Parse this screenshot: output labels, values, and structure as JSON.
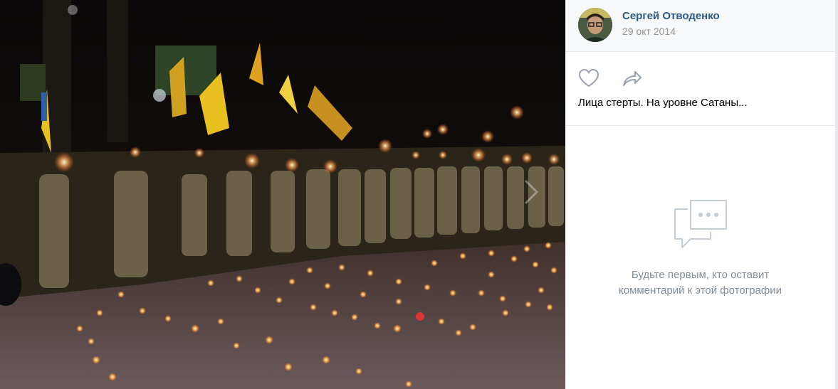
{
  "photo": {
    "alt_icon": "photo-viewer-image",
    "nav_icon": "chevron-right-icon"
  },
  "header": {
    "author": "Сергей Отводенко",
    "date": "29 окт 2014",
    "avatar_icon": "user-avatar"
  },
  "actions": {
    "like_icon": "heart-icon",
    "share_icon": "share-arrow-icon"
  },
  "caption": "Лица стерты. На уровне Сатаны...",
  "comments": {
    "empty_icon": "comment-bubble-icon",
    "empty_line1": "Будьте первым, кто оставит",
    "empty_line2": "комментарий к этой фотографии"
  },
  "colors": {
    "link": "#2a5885",
    "muted": "#939393",
    "empty_text": "#818c99",
    "header_bg": "#f7f8fa",
    "icon": "#99a2ad"
  }
}
